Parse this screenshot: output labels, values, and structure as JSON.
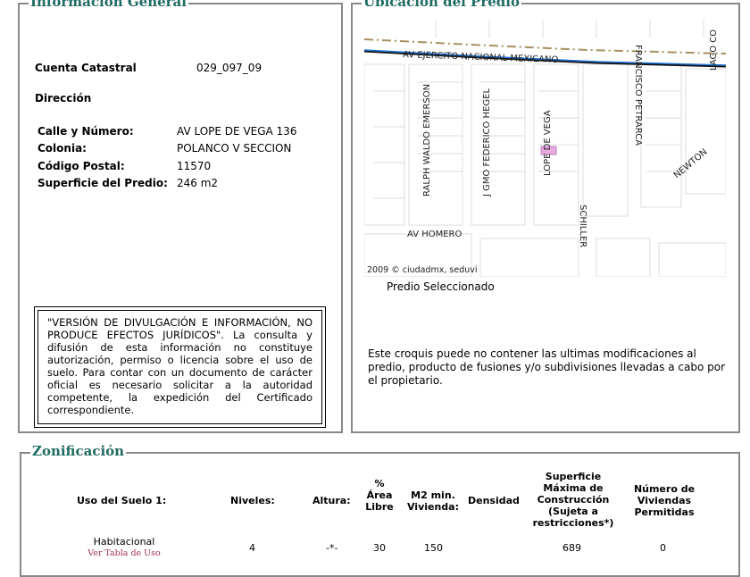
{
  "info": {
    "title": "Información General",
    "cuenta_label": "Cuenta Catastral",
    "cuenta_value": "029_097_09",
    "direccion_label": "Dirección",
    "rows": [
      {
        "label": "Calle y Número:",
        "value": "AV LOPE DE VEGA 136"
      },
      {
        "label": "Colonia:",
        "value": "POLANCO V SECCION"
      },
      {
        "label": "Código Postal:",
        "value": "11570"
      },
      {
        "label": "Superficie del Predio:",
        "value": "246 m2"
      }
    ],
    "disclaimer": "\"VERSIÓN DE DIVULGACIÓN E INFORMACIÓN, NO PRODUCE EFECTOS JURÍDICOS\". La consulta y difusión de esta información no constituye autorización, permiso o licencia sobre el uso de suelo. Para contar con un documento de carácter oficial es necesario solicitar a la autoridad competente, la expedición del Certificado correspondiente."
  },
  "ubicacion": {
    "title": "Ubicación del Predio",
    "streets": {
      "ejercito": "AV EJERCITO NACIONAL MEXICANO",
      "emerson": "RALPH WALDO EMERSON",
      "hegel": "J GMO FEDERICO HEGEL",
      "lope": "LOPE DE VEGA",
      "petrarca": "FRANCISCO PETRARCA",
      "lago": "LAGO CO",
      "newton": "NEWTON",
      "schiller": "SCHILLER",
      "homero": "AV HOMERO"
    },
    "copyright": "2009 © ciudadmx, seduvi",
    "caption": "Predio Seleccionado",
    "note": "Este croquis puede no contener las ultimas modificaciones al predio, producto de fusiones y/o subdivisiones llevadas a cabo por el propietario.",
    "colors": {
      "highlight": "#e8a8e0",
      "road_blue": "#1e73d8",
      "boundary": "#a89060"
    }
  },
  "zonificacion": {
    "title": "Zonificación",
    "headers": [
      "Uso del Suelo 1:",
      "Niveles:",
      "Altura:",
      "% Área Libre",
      "M2 min. Vivienda:",
      "Densidad",
      "Superficie Máxima de Construcción (Sujeta a restricciones*)",
      "Número de Viviendas Permitidas"
    ],
    "row": {
      "uso": "Habitacional",
      "link": "Ver Tabla de Uso",
      "niveles": "4",
      "altura": "-*-",
      "area_libre": "30",
      "m2_min": "150",
      "densidad": "",
      "superficie": "689",
      "viviendas": "0"
    }
  },
  "colors": {
    "legend": "#1f6b63",
    "link": "#a0305a"
  }
}
